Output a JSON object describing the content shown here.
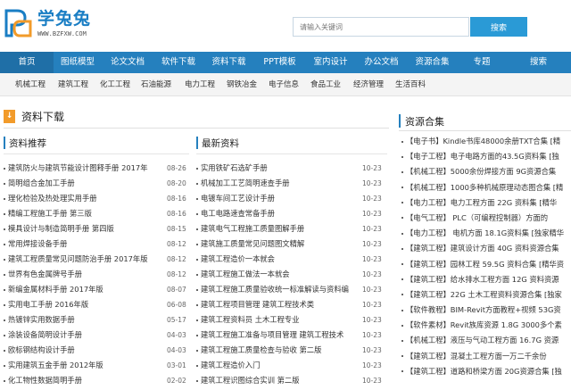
{
  "header": {
    "logo_text": "学兔兔",
    "logo_url": "WWW.BZFXW.COM",
    "search_placeholder": "请输入关键词",
    "search_button": "搜索",
    "colors": {
      "brand": "#1a7ec4",
      "nav": "#2580be",
      "accent": "#f29b2a"
    }
  },
  "nav": {
    "items": [
      "首页",
      "图纸模型",
      "论文文档",
      "软件下载",
      "资料下载",
      "PPT模板",
      "室内设计",
      "办公文档",
      "资源合集",
      "专题",
      "搜索"
    ]
  },
  "subnav": {
    "items": [
      "机械工程",
      "建筑工程",
      "化工工程",
      "石油能源",
      "电力工程",
      "钢铁冶金",
      "电子信息",
      "食品工业",
      "经济管理",
      "生活百科"
    ]
  },
  "section": {
    "icon": "download-icon",
    "title": "资料下载"
  },
  "recommended": {
    "title": "资料推荐",
    "items": [
      {
        "title": "建筑防火与建筑节能设计图释手册 2017年",
        "date": "08-26"
      },
      {
        "title": "简明组合金加工手册",
        "date": "08-20"
      },
      {
        "title": "理化检验及热处理实用手册",
        "date": "08-16"
      },
      {
        "title": "精编工程施工手册 第三版",
        "date": "08-16"
      },
      {
        "title": "模具设计与制造简明手册 第四版",
        "date": "08-15"
      },
      {
        "title": "常用焊接设备手册",
        "date": "08-12"
      },
      {
        "title": "建筑工程质量常见问题防治手册 2017年版",
        "date": "08-12"
      },
      {
        "title": "世界有色金属牌号手册",
        "date": "08-12"
      },
      {
        "title": "新编金属材料手册 2017年版",
        "date": "08-07"
      },
      {
        "title": "实用电工手册 2016年版",
        "date": "06-08"
      },
      {
        "title": "热镀锌实用数据手册",
        "date": "05-17"
      },
      {
        "title": "涂装设备简明设计手册",
        "date": "04-03"
      },
      {
        "title": "欧标钢结构设计手册",
        "date": "04-03"
      },
      {
        "title": "实用建筑五金手册 2012年版",
        "date": "03-01"
      },
      {
        "title": "化工物性数据简明手册",
        "date": "02-02"
      }
    ]
  },
  "latest": {
    "title": "最新资料",
    "items": [
      {
        "title": "实用铁矿石选矿手册",
        "date": "10-23"
      },
      {
        "title": "机械加工工艺简明速查手册",
        "date": "10-23"
      },
      {
        "title": "电镀车间工艺设计手册",
        "date": "10-23"
      },
      {
        "title": "电工电路速查常备手册",
        "date": "10-23"
      },
      {
        "title": "建筑电气工程施工质量图解手册",
        "date": "10-23"
      },
      {
        "title": "建筑施工质量常见问题图文精解",
        "date": "10-23"
      },
      {
        "title": "建筑工程造价一本就会",
        "date": "10-23"
      },
      {
        "title": "建筑工程施工做法一本就会",
        "date": "10-23"
      },
      {
        "title": "建筑工程施工质量验收统一标准解读与资料编",
        "date": "10-23"
      },
      {
        "title": "建筑工程项目管理 建筑工程技术类",
        "date": "10-23"
      },
      {
        "title": "建筑工程资料员 土木工程专业",
        "date": "10-23"
      },
      {
        "title": "建筑工程施工准备与项目管理 建筑工程技术",
        "date": "10-23"
      },
      {
        "title": "建筑工程施工质量检查与验收 第二版",
        "date": "10-23"
      },
      {
        "title": "建筑工程造价入门",
        "date": "10-23"
      },
      {
        "title": "建筑工程识图综合实训 第二版",
        "date": "10-23"
      }
    ]
  },
  "resources": {
    "title": "资源合集",
    "items": [
      "【电子书】Kindle书库48000余册TXT合集 [精",
      "【电子工程】电子电路方面的43.5G资料集 [独",
      "【机械工程】5000余份焊接方面 9G资源合集",
      "【机械工程】1000多种机械原理动态图合集 [精",
      "【电力工程】电力工程方面 22G 资料集 [精华",
      "【电气工程】 PLC（可编程控制器）方面的",
      "【电力工程】 电机方面 18.1G资料集 [独家精华",
      "【建筑工程】建筑设计方面 40G 资料资源合集",
      "【建筑工程】园林工程 59.5G 资料合集 [精华资",
      "【建筑工程】给水排水工程方面 12G 资料资源",
      "【建筑工程】22G 土木工程资料资源合集 [独家",
      "【软件教程】BIM-Revit方面教程+视频 53G资",
      "【软件素材】Revit族库资源 1.8G 3000多个素",
      "【机械工程】液压与气动工程方面 16.7G 资源",
      "【建筑工程】混凝土工程方面一万二千余份",
      "【建筑工程】道路和桥梁方面 20G资源合集 [独"
    ]
  }
}
